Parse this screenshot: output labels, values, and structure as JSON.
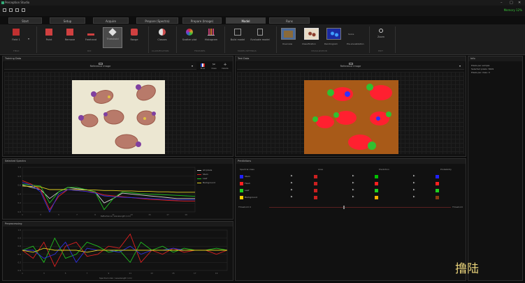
{
  "window": {
    "title": "Perception Studio",
    "controls": [
      "–",
      "□",
      "✕"
    ]
  },
  "quick_toolbar": {
    "icons": [
      "new-icon",
      "open-icon",
      "save-icon",
      "save-as-icon"
    ],
    "memory": "Memory 12%"
  },
  "tabs": [
    {
      "label": "Start",
      "active": false
    },
    {
      "label": "Setup",
      "active": false
    },
    {
      "label": "Acquire",
      "active": false
    },
    {
      "label": "Prepare (Spectra)",
      "active": false
    },
    {
      "label": "Prepare (Image)",
      "active": false
    },
    {
      "label": "Model",
      "active": true
    },
    {
      "label": "Runs",
      "active": false
    }
  ],
  "ribbon": {
    "field_label": "Field 1",
    "buttons": [
      {
        "label": "Point",
        "color": "#d04040"
      },
      {
        "label": "Remove",
        "color": "#d04040"
      },
      {
        "label": "Freehand",
        "color": "#d04040"
      },
      {
        "label": "Threshold",
        "color": "#d04040",
        "selected": true
      },
      {
        "label": "Range",
        "color": "#d04040"
      },
      {
        "label": "Classes",
        "color": "#d05050"
      },
      {
        "label": "Scatter plot",
        "color": "#d07030"
      },
      {
        "label": "Histogram",
        "color": "#c04070"
      },
      {
        "label": "Build model",
        "color": "#999999"
      },
      {
        "label": "Evaluate model",
        "color": "#999999"
      },
      {
        "label": "Zoom",
        "color": "#cccccc"
      }
    ],
    "groups": [
      "FIELD",
      "ROI",
      "CLASSIFICATION",
      "FEATURES",
      "MODEL/SETTINGS",
      "VISUALIZATION",
      "EDIT"
    ],
    "vis_labels": [
      "Overview",
      "Classification",
      "Dendrogram",
      "Score",
      "Pre-visualization"
    ]
  },
  "training": {
    "title": "Training Data",
    "selector": "Reference image",
    "tools": [
      "Pixel",
      "Class",
      "Delete"
    ]
  },
  "test": {
    "title": "Test Data",
    "selector": "Reference image"
  },
  "spectra": {
    "title": "Selected Spectra",
    "legend": [
      "All pixels",
      "Stem",
      "Leaf",
      "Background"
    ],
    "xlabel": "Reflectance / wavelength (nm)"
  },
  "preproc": {
    "title": "Preprocessing",
    "xlabel": "Spectral index / wavelength (nm)"
  },
  "classes": {
    "title": "Predictions",
    "columns": [
      "Spectral class",
      "Area",
      "Prediction",
      "Probability"
    ],
    "rows": [
      {
        "name": "Stem",
        "c1": "#2020ff",
        "c2": "#cc2020",
        "c3": "#00c000",
        "c4": "#2020ff"
      },
      {
        "name": "Flesh",
        "c1": "#ff2020",
        "c2": "#cc2020",
        "c3": "#ff2020",
        "c4": "#ff2020"
      },
      {
        "name": "Leaf",
        "c1": "#20d020",
        "c2": "#cc2020",
        "c3": "#20d020",
        "c4": "#20d020"
      },
      {
        "name": "Background",
        "c1": "#ffd000",
        "c2": "#cc2020",
        "c3": "#ffb000",
        "c4": "#8a3a10"
      }
    ],
    "slider_label": "Threshold",
    "slider_value": "0",
    "slider_end": "Threshold"
  },
  "info": {
    "title": "Info",
    "lines": [
      "Pixels per sample",
      "Selected pixels: 8449",
      "Pixels per class: 0"
    ]
  },
  "watermark": "撸陆",
  "chart_data": [
    {
      "type": "line",
      "title": "Selected Spectra",
      "xlabel": "Reflectance / wavelength (nm)",
      "x": [
        1,
        2,
        3,
        4,
        5,
        6,
        7,
        8,
        9,
        10,
        11,
        12,
        13,
        14,
        15,
        16,
        17,
        18,
        19,
        20
      ],
      "series": [
        {
          "name": "All pixels",
          "color": "#d0d0d0",
          "values": [
            0.6,
            0.55,
            0.5,
            0.3,
            0.45,
            0.55,
            0.52,
            0.5,
            0.45,
            0.2,
            0.3,
            0.42,
            0.4,
            0.38,
            0.36,
            0.34,
            0.32,
            0.3,
            0.3,
            0.3
          ]
        },
        {
          "name": "Stem",
          "color": "#e02020",
          "values": [
            0.7,
            0.62,
            0.5,
            0.05,
            0.35,
            0.5,
            0.48,
            0.46,
            0.44,
            0.38,
            0.36,
            0.34,
            0.32,
            0.3,
            0.28,
            0.27,
            0.26,
            0.25,
            0.24,
            0.24
          ]
        },
        {
          "name": "Leaf",
          "color": "#20c020",
          "values": [
            0.62,
            0.6,
            0.58,
            0.2,
            0.45,
            0.55,
            0.55,
            0.5,
            0.45,
            0.05,
            0.3,
            0.45,
            0.43,
            0.41,
            0.4,
            0.39,
            0.38,
            0.37,
            0.36,
            0.35
          ]
        },
        {
          "name": "Background",
          "color": "#e0d020",
          "values": [
            0.58,
            0.57,
            0.56,
            0.5,
            0.5,
            0.5,
            0.5,
            0.49,
            0.49,
            0.48,
            0.48,
            0.47,
            0.47,
            0.46,
            0.46,
            0.45,
            0.45,
            0.44,
            0.44,
            0.44
          ]
        },
        {
          "color": "#3030e0",
          "values": [
            0.66,
            0.6,
            0.45,
            0.0,
            0.4,
            0.5,
            0.48,
            0.46,
            0.42,
            0.36,
            0.34,
            0.33,
            0.32,
            0.31,
            0.3,
            0.29,
            0.28,
            0.27,
            0.27,
            0.27
          ]
        }
      ],
      "ylim": [
        0,
        1
      ]
    },
    {
      "type": "line",
      "title": "Preprocessing",
      "xlabel": "Spectral index / wavelength (nm)",
      "x": [
        1,
        2,
        3,
        4,
        5,
        6,
        7,
        8,
        9,
        10,
        11,
        12,
        13,
        14,
        15,
        16,
        17,
        18,
        19,
        20
      ],
      "series": [
        {
          "color": "#e02020",
          "values": [
            0.5,
            0.3,
            0.7,
            0.1,
            0.6,
            0.7,
            0.35,
            0.4,
            0.6,
            0.55,
            0.9,
            0.2,
            0.5,
            0.4,
            0.55,
            0.45,
            0.5,
            0.5,
            0.4,
            0.5
          ]
        },
        {
          "color": "#20c020",
          "values": [
            0.5,
            0.6,
            0.2,
            0.8,
            0.3,
            0.4,
            0.7,
            0.6,
            0.45,
            0.5,
            0.2,
            0.7,
            0.5,
            0.6,
            0.45,
            0.55,
            0.5,
            0.5,
            0.55,
            0.5
          ]
        },
        {
          "color": "#3030e0",
          "values": [
            0.5,
            0.5,
            0.3,
            0.4,
            0.7,
            0.2,
            0.55,
            0.5,
            0.5,
            0.45,
            0.6,
            0.4,
            0.5,
            0.5,
            0.55,
            0.5,
            0.5,
            0.5,
            0.5,
            0.5
          ]
        },
        {
          "color": "#e0d020",
          "values": [
            0.5,
            0.45,
            0.55,
            0.5,
            0.5,
            0.5,
            0.45,
            0.5,
            0.5,
            0.5,
            0.5,
            0.5,
            0.5,
            0.5,
            0.5,
            0.5,
            0.5,
            0.5,
            0.5,
            0.5
          ]
        }
      ],
      "ylim": [
        0,
        1
      ]
    }
  ]
}
